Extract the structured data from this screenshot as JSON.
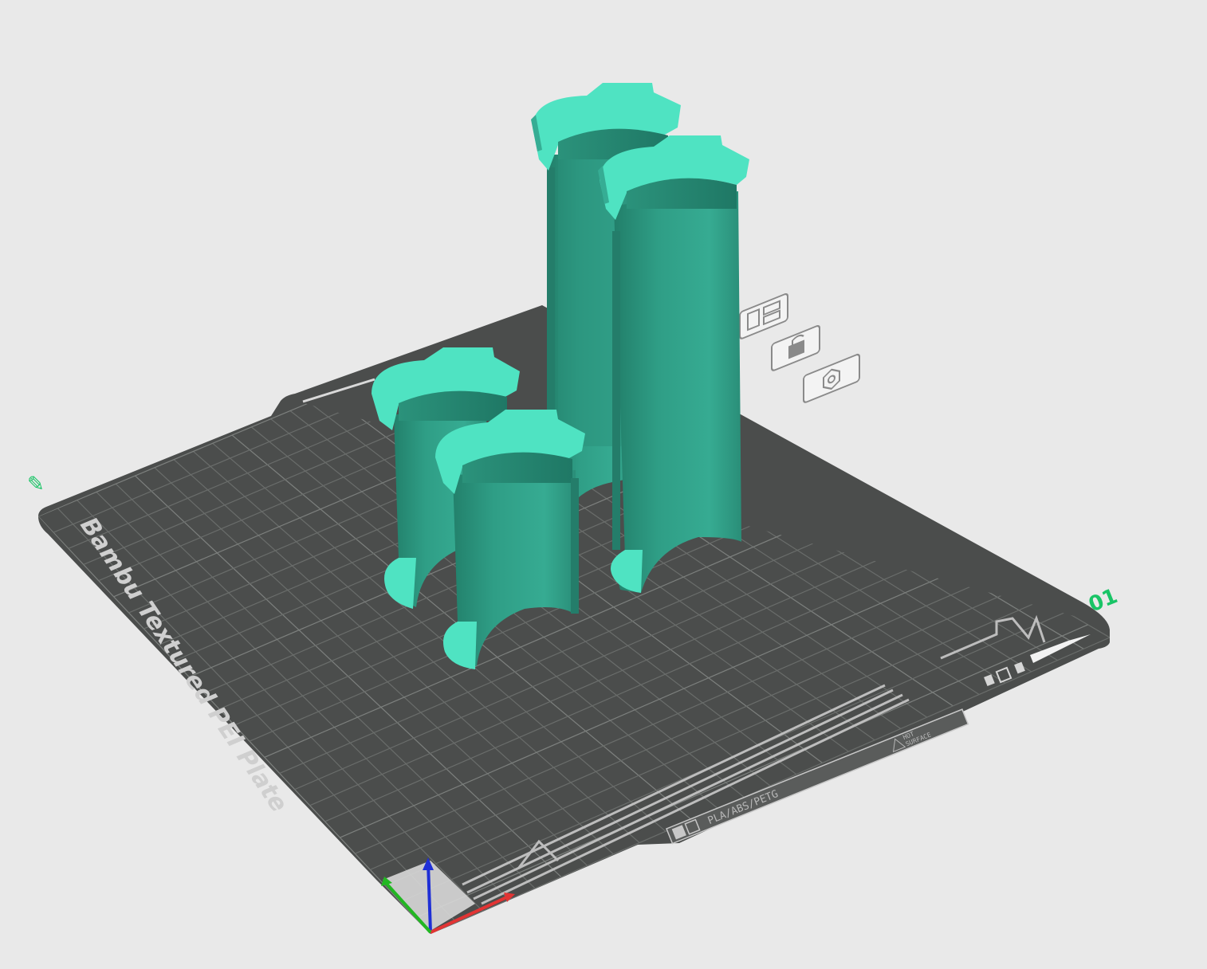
{
  "plate": {
    "name": "Bambu Textured PEI Plate",
    "materials": "PLA/ABS/PETG",
    "warning_line1": "HOT",
    "warning_line2": "SURFACE",
    "plate_number": "01",
    "plate_edit_glyph": "✎"
  },
  "colors": {
    "background": "#e9e9e9",
    "plate": "#4b4d4c",
    "grid": "#6e716f",
    "model_body": "#2e9c84",
    "model_top": "#4fe3c2",
    "plate_number": "#19c466",
    "axis_x": "#e23434",
    "axis_y": "#22b722",
    "axis_z": "#1f2fd6"
  },
  "plate_toolbar": [
    "arrange-icon",
    "orient-icon",
    "lock-icon",
    "settings-icon"
  ],
  "objects": [
    "tube-short-back",
    "tube-short-front",
    "tube-tall-back",
    "tube-tall-front"
  ]
}
